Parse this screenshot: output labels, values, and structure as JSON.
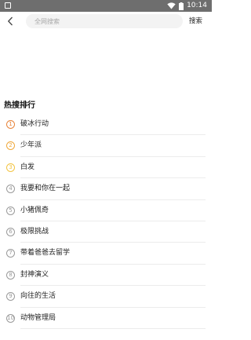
{
  "status_bar": {
    "time": "10:14"
  },
  "header": {
    "search_placeholder": "全网搜索",
    "search_label": "搜索"
  },
  "hot": {
    "title": "热搜排行",
    "items": [
      {
        "rank": "1",
        "name": "破冰行动",
        "color": "#e8843a"
      },
      {
        "rank": "2",
        "name": "少年派",
        "color": "#f0a93c"
      },
      {
        "rank": "3",
        "name": "白发",
        "color": "#f2c443"
      },
      {
        "rank": "4",
        "name": "我要和你在一起",
        "color": "#9a9a9a"
      },
      {
        "rank": "5",
        "name": "小猪佩奇",
        "color": "#9a9a9a"
      },
      {
        "rank": "6",
        "name": "极限挑战",
        "color": "#9a9a9a"
      },
      {
        "rank": "7",
        "name": "带着爸爸去留学",
        "color": "#9a9a9a"
      },
      {
        "rank": "8",
        "name": "封神演义",
        "color": "#9a9a9a"
      },
      {
        "rank": "9",
        "name": "向往的生活",
        "color": "#9a9a9a"
      },
      {
        "rank": "10",
        "name": "动物管理局",
        "color": "#9a9a9a"
      }
    ]
  }
}
